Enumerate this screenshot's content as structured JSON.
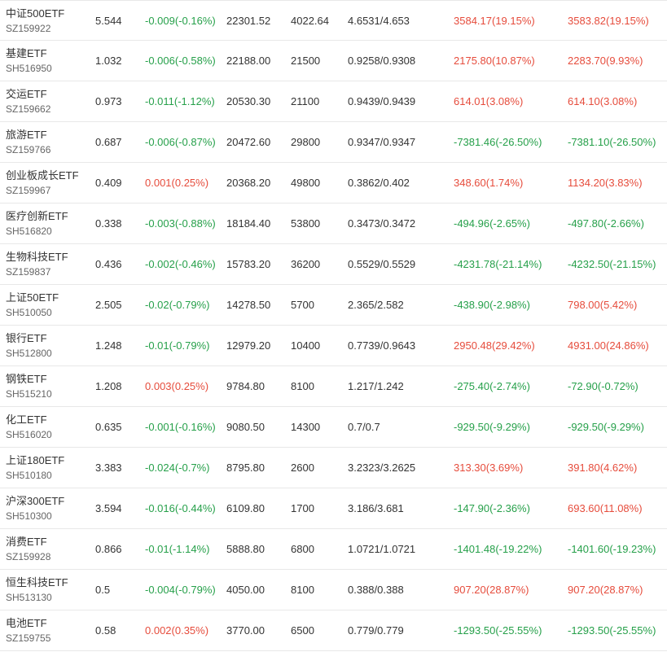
{
  "colors": {
    "up": "#e64c3c",
    "down": "#26a04a",
    "text": "#333333",
    "subtext": "#666666",
    "border": "#e8e8e8"
  },
  "rows": [
    {
      "name": "中证500ETF",
      "code": "SZ159922",
      "price": "5.544",
      "change": "-0.009(-0.16%)",
      "change_dir": "down",
      "amount": "22301.52",
      "volume": "4022.64",
      "bid_ask": "4.6531/4.653",
      "pnl1": "3584.17(19.15%)",
      "pnl1_dir": "up",
      "pnl2": "3583.82(19.15%)",
      "pnl2_dir": "up"
    },
    {
      "name": "基建ETF",
      "code": "SH516950",
      "price": "1.032",
      "change": "-0.006(-0.58%)",
      "change_dir": "down",
      "amount": "22188.00",
      "volume": "21500",
      "bid_ask": "0.9258/0.9308",
      "pnl1": "2175.80(10.87%)",
      "pnl1_dir": "up",
      "pnl2": "2283.70(9.93%)",
      "pnl2_dir": "up"
    },
    {
      "name": "交运ETF",
      "code": "SZ159662",
      "price": "0.973",
      "change": "-0.011(-1.12%)",
      "change_dir": "down",
      "amount": "20530.30",
      "volume": "21100",
      "bid_ask": "0.9439/0.9439",
      "pnl1": "614.01(3.08%)",
      "pnl1_dir": "up",
      "pnl2": "614.10(3.08%)",
      "pnl2_dir": "up"
    },
    {
      "name": "旅游ETF",
      "code": "SZ159766",
      "price": "0.687",
      "change": "-0.006(-0.87%)",
      "change_dir": "down",
      "amount": "20472.60",
      "volume": "29800",
      "bid_ask": "0.9347/0.9347",
      "pnl1": "-7381.46(-26.50%)",
      "pnl1_dir": "down",
      "pnl2": "-7381.10(-26.50%)",
      "pnl2_dir": "down"
    },
    {
      "name": "创业板成长ETF",
      "code": "SZ159967",
      "price": "0.409",
      "change": "0.001(0.25%)",
      "change_dir": "up",
      "amount": "20368.20",
      "volume": "49800",
      "bid_ask": "0.3862/0.402",
      "pnl1": "348.60(1.74%)",
      "pnl1_dir": "up",
      "pnl2": "1134.20(3.83%)",
      "pnl2_dir": "up"
    },
    {
      "name": "医疗创新ETF",
      "code": "SH516820",
      "price": "0.338",
      "change": "-0.003(-0.88%)",
      "change_dir": "down",
      "amount": "18184.40",
      "volume": "53800",
      "bid_ask": "0.3473/0.3472",
      "pnl1": "-494.96(-2.65%)",
      "pnl1_dir": "down",
      "pnl2": "-497.80(-2.66%)",
      "pnl2_dir": "down"
    },
    {
      "name": "生物科技ETF",
      "code": "SZ159837",
      "price": "0.436",
      "change": "-0.002(-0.46%)",
      "change_dir": "down",
      "amount": "15783.20",
      "volume": "36200",
      "bid_ask": "0.5529/0.5529",
      "pnl1": "-4231.78(-21.14%)",
      "pnl1_dir": "down",
      "pnl2": "-4232.50(-21.15%)",
      "pnl2_dir": "down"
    },
    {
      "name": "上证50ETF",
      "code": "SH510050",
      "price": "2.505",
      "change": "-0.02(-0.79%)",
      "change_dir": "down",
      "amount": "14278.50",
      "volume": "5700",
      "bid_ask": "2.365/2.582",
      "pnl1": "-438.90(-2.98%)",
      "pnl1_dir": "down",
      "pnl2": "798.00(5.42%)",
      "pnl2_dir": "up"
    },
    {
      "name": "银行ETF",
      "code": "SH512800",
      "price": "1.248",
      "change": "-0.01(-0.79%)",
      "change_dir": "down",
      "amount": "12979.20",
      "volume": "10400",
      "bid_ask": "0.7739/0.9643",
      "pnl1": "2950.48(29.42%)",
      "pnl1_dir": "up",
      "pnl2": "4931.00(24.86%)",
      "pnl2_dir": "up"
    },
    {
      "name": "钢铁ETF",
      "code": "SH515210",
      "price": "1.208",
      "change": "0.003(0.25%)",
      "change_dir": "up",
      "amount": "9784.80",
      "volume": "8100",
      "bid_ask": "1.217/1.242",
      "pnl1": "-275.40(-2.74%)",
      "pnl1_dir": "down",
      "pnl2": "-72.90(-0.72%)",
      "pnl2_dir": "down"
    },
    {
      "name": "化工ETF",
      "code": "SH516020",
      "price": "0.635",
      "change": "-0.001(-0.16%)",
      "change_dir": "down",
      "amount": "9080.50",
      "volume": "14300",
      "bid_ask": "0.7/0.7",
      "pnl1": "-929.50(-9.29%)",
      "pnl1_dir": "down",
      "pnl2": "-929.50(-9.29%)",
      "pnl2_dir": "down"
    },
    {
      "name": "上证180ETF",
      "code": "SH510180",
      "price": "3.383",
      "change": "-0.024(-0.7%)",
      "change_dir": "down",
      "amount": "8795.80",
      "volume": "2600",
      "bid_ask": "3.2323/3.2625",
      "pnl1": "313.30(3.69%)",
      "pnl1_dir": "up",
      "pnl2": "391.80(4.62%)",
      "pnl2_dir": "up"
    },
    {
      "name": "沪深300ETF",
      "code": "SH510300",
      "price": "3.594",
      "change": "-0.016(-0.44%)",
      "change_dir": "down",
      "amount": "6109.80",
      "volume": "1700",
      "bid_ask": "3.186/3.681",
      "pnl1": "-147.90(-2.36%)",
      "pnl1_dir": "down",
      "pnl2": "693.60(11.08%)",
      "pnl2_dir": "up"
    },
    {
      "name": "消费ETF",
      "code": "SZ159928",
      "price": "0.866",
      "change": "-0.01(-1.14%)",
      "change_dir": "down",
      "amount": "5888.80",
      "volume": "6800",
      "bid_ask": "1.0721/1.0721",
      "pnl1": "-1401.48(-19.22%)",
      "pnl1_dir": "down",
      "pnl2": "-1401.60(-19.23%)",
      "pnl2_dir": "down"
    },
    {
      "name": "恒生科技ETF",
      "code": "SH513130",
      "price": "0.5",
      "change": "-0.004(-0.79%)",
      "change_dir": "down",
      "amount": "4050.00",
      "volume": "8100",
      "bid_ask": "0.388/0.388",
      "pnl1": "907.20(28.87%)",
      "pnl1_dir": "up",
      "pnl2": "907.20(28.87%)",
      "pnl2_dir": "up"
    },
    {
      "name": "电池ETF",
      "code": "SZ159755",
      "price": "0.58",
      "change": "0.002(0.35%)",
      "change_dir": "up",
      "amount": "3770.00",
      "volume": "6500",
      "bid_ask": "0.779/0.779",
      "pnl1": "-1293.50(-25.55%)",
      "pnl1_dir": "down",
      "pnl2": "-1293.50(-25.55%)",
      "pnl2_dir": "down"
    }
  ]
}
